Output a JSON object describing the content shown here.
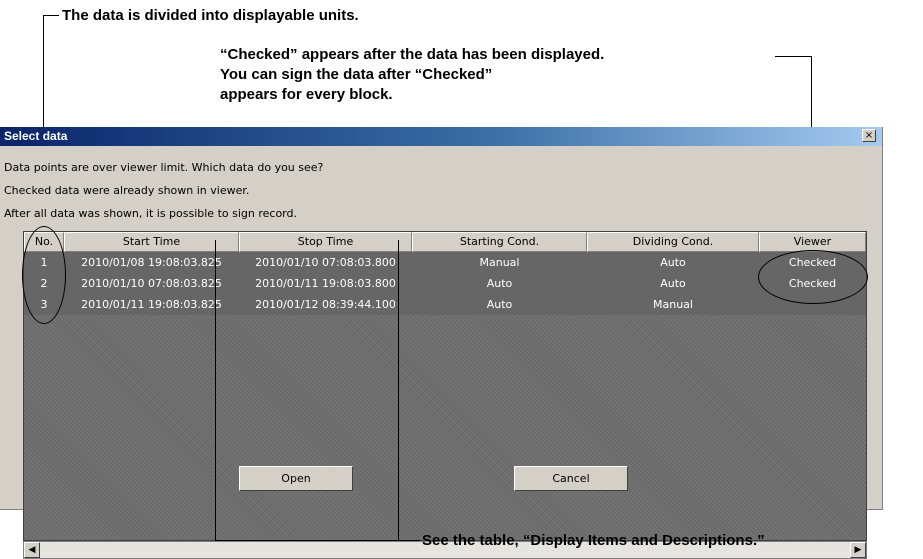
{
  "annotations": {
    "divided": "The data is divided into displayable units.",
    "checked_line1": "“Checked” appears after the data has been displayed.",
    "checked_line2": "You can sign the data after “Checked”",
    "checked_line3": "appears for every block.",
    "see_table": "See the table, “Display Items and Descriptions.”"
  },
  "dialog": {
    "title": "Select data",
    "close_glyph": "×",
    "messages": [
      "Data points are over viewer limit. Which data do you see?",
      "Checked data were already shown in viewer.",
      "After all data was shown, it is possible to sign record."
    ],
    "columns": [
      "No.",
      "Start Time",
      "Stop Time",
      "Starting Cond.",
      "Dividing Cond.",
      "Viewer"
    ],
    "rows": [
      [
        "1",
        "2010/01/08 19:08:03.825",
        "2010/01/10 07:08:03.800",
        "Manual",
        "Auto",
        "Checked"
      ],
      [
        "2",
        "2010/01/10 07:08:03.825",
        "2010/01/11 19:08:03.800",
        "Auto",
        "Auto",
        "Checked"
      ],
      [
        "3",
        "2010/01/11 19:08:03.825",
        "2010/01/12 08:39:44.100",
        "Auto",
        "Manual",
        ""
      ]
    ],
    "scroll_left_glyph": "◀",
    "scroll_right_glyph": "▶",
    "buttons": {
      "open": "Open",
      "cancel": "Cancel"
    }
  },
  "colors": {
    "title_gradient_start": "#0a246a",
    "title_gradient_end": "#a6caf0",
    "dialog_face": "#d4d0c8",
    "row_background": "#666666"
  }
}
